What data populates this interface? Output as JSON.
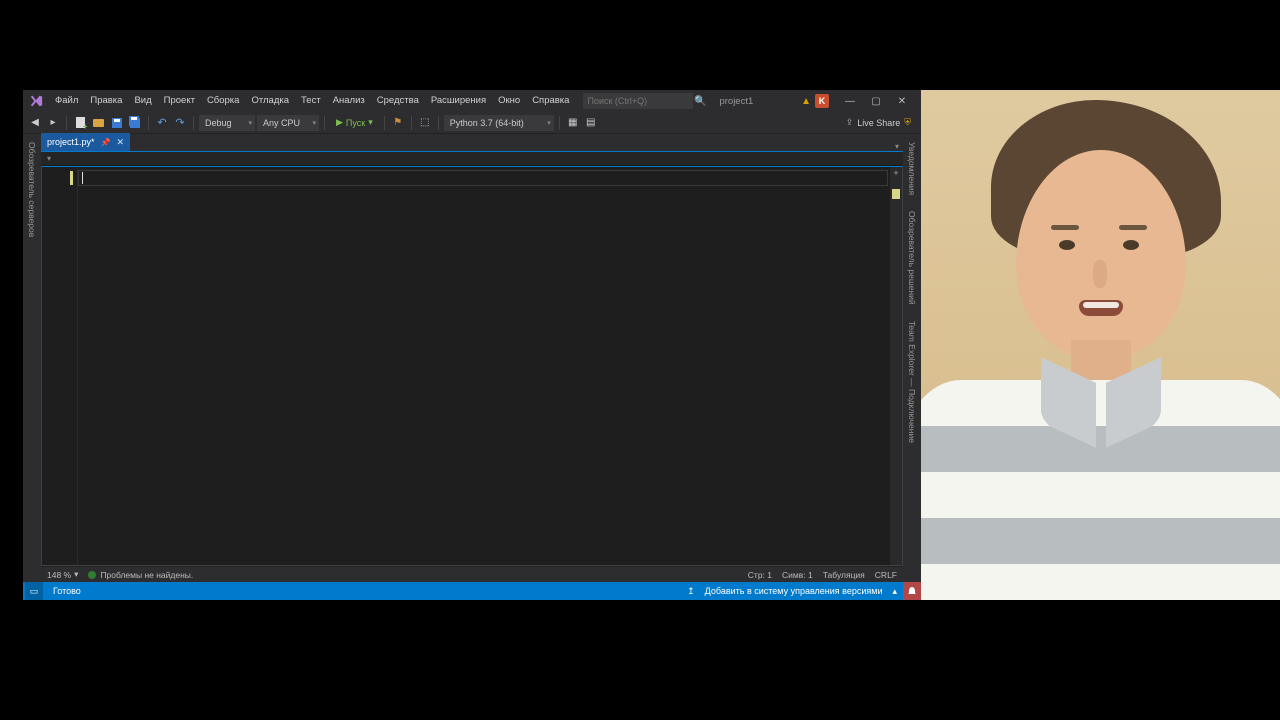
{
  "menu": {
    "file": "Файл",
    "edit": "Правка",
    "view": "Вид",
    "project": "Проект",
    "build": "Сборка",
    "debug": "Отладка",
    "test": "Тест",
    "analyze": "Анализ",
    "tools": "Средства",
    "extensions": "Расширения",
    "window": "Окно",
    "help": "Справка"
  },
  "search": {
    "placeholder": "Поиск (Ctrl+Q)"
  },
  "solution_name": "project1",
  "user_initial": "K",
  "toolbar": {
    "config": "Debug",
    "platform": "Any CPU",
    "run": "Пуск",
    "python": "Python 3.7 (64-bit)"
  },
  "live_share": "Live Share",
  "side_left": {
    "server_explorer": "Обозреватель серверов"
  },
  "side_right": {
    "notifications": "Уведомления",
    "solution_explorer": "Обозреватель решений",
    "team_explorer": "Team Explorer — Подключение"
  },
  "tab": {
    "filename": "project1.py*",
    "modified_marker": "●"
  },
  "editor_status": {
    "zoom": "148 %",
    "issues": "Проблемы не найдены.",
    "line": "Стр: 1",
    "col": "Симв: 1",
    "indent": "Табуляция",
    "lineend": "CRLF"
  },
  "statusbar": {
    "ready": "Готово",
    "add_vcs": "Добавить в систему управления версиями"
  }
}
